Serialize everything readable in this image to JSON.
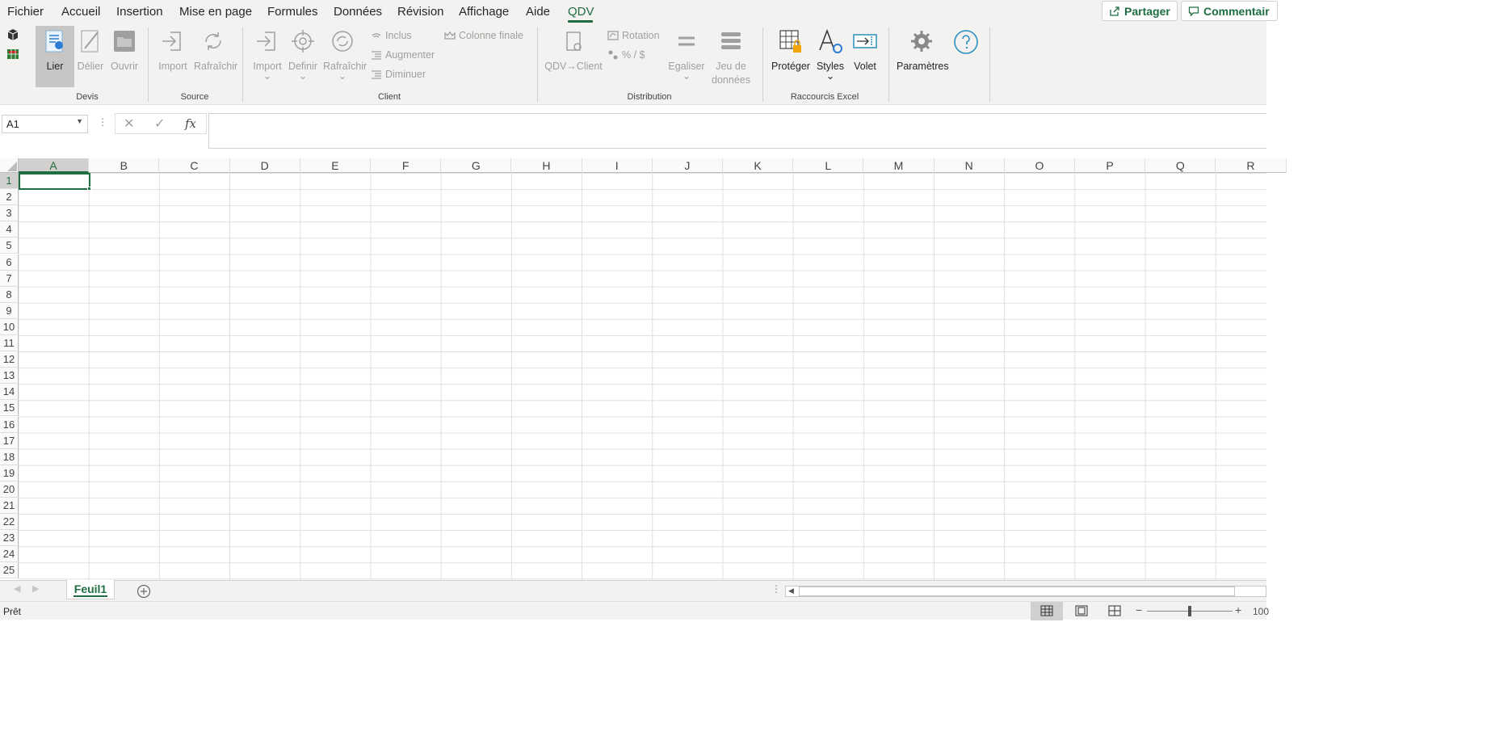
{
  "menu": {
    "tabs": [
      "Fichier",
      "Accueil",
      "Insertion",
      "Mise en page",
      "Formules",
      "Données",
      "Révision",
      "Affichage",
      "Aide",
      "QDV"
    ],
    "share_label": "Partager",
    "comments_label": "Commentair"
  },
  "ribbon": {
    "devis": {
      "label": "Devis",
      "lier": "Lier",
      "delier": "Délier",
      "ouvrir": "Ouvrir"
    },
    "source": {
      "label": "Source",
      "import": "Import",
      "rafraichir": "Rafraîchir"
    },
    "client": {
      "label": "Client",
      "import": "Import",
      "definir": "Definir",
      "rafraichir": "Rafraîchir",
      "inclus": "Inclus",
      "augmenter": "Augmenter",
      "diminuer": "Diminuer",
      "colonne_finale": "Colonne finale"
    },
    "distribution": {
      "label": "Distribution",
      "qdv_client": "QDV→Client",
      "rotation": "Rotation",
      "pct": "% / $",
      "egaliser": "Egaliser",
      "jeu_de": "Jeu de",
      "donnees": "données"
    },
    "excel": {
      "label": "Raccourcis Excel",
      "proteger": "Protéger",
      "styles": "Styles",
      "volet": "Volet"
    },
    "misc": {
      "parametres": "Paramètres"
    }
  },
  "formula_bar": {
    "name_box": "A1",
    "fx": "fx",
    "formula": ""
  },
  "grid": {
    "columns": [
      "A",
      "B",
      "C",
      "D",
      "E",
      "F",
      "G",
      "H",
      "I",
      "J",
      "K",
      "L",
      "M",
      "N",
      "O",
      "P",
      "Q",
      "R"
    ],
    "rows": [
      "1",
      "2",
      "3",
      "4",
      "5",
      "6",
      "7",
      "8",
      "9",
      "10",
      "11",
      "12",
      "13",
      "14",
      "15",
      "16",
      "17",
      "18",
      "19",
      "20",
      "21",
      "22",
      "23",
      "24",
      "25"
    ],
    "selected_cell": "A1"
  },
  "sheets": {
    "active": "Feuil1"
  },
  "status": {
    "ready": "Prêt",
    "zoom": "100"
  },
  "colors": {
    "accent": "#1e6e42"
  }
}
